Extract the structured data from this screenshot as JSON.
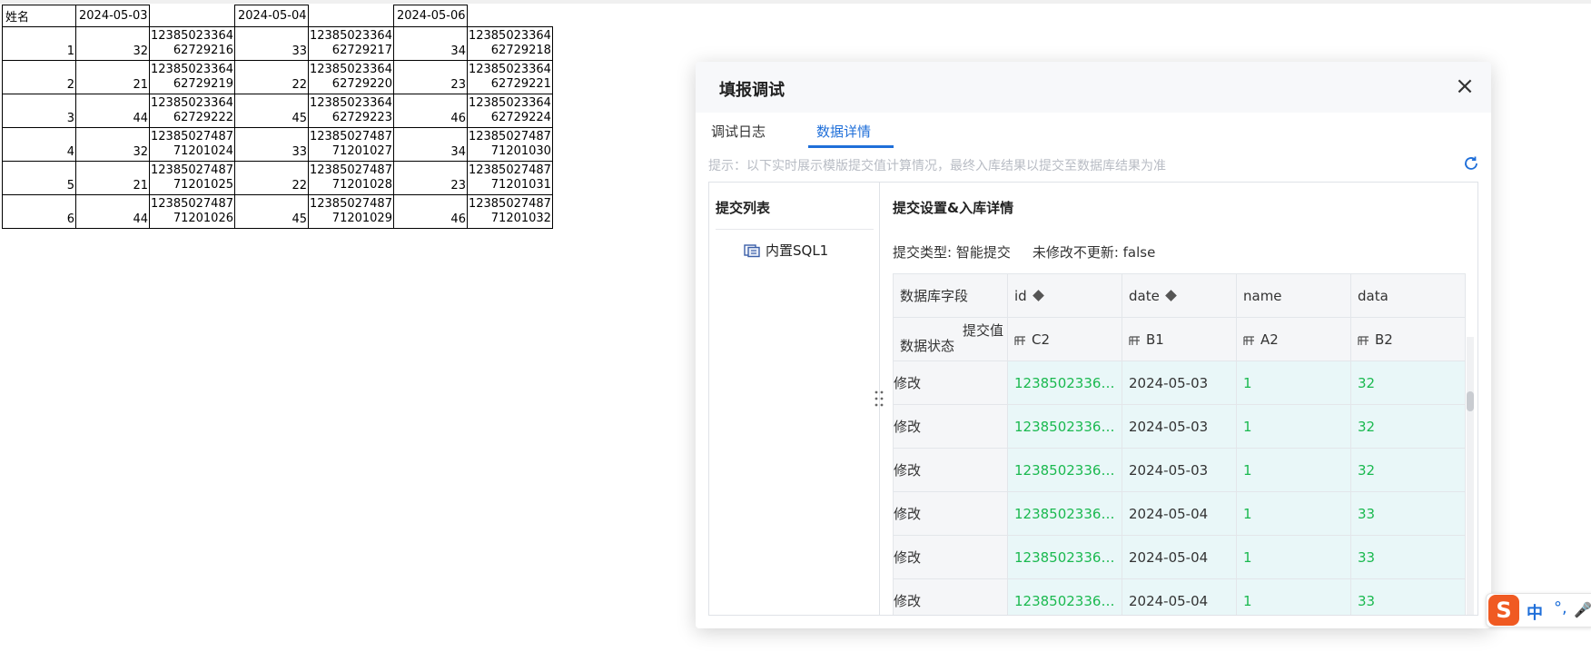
{
  "sheet": {
    "header": [
      "姓名",
      "2024-05-03",
      "",
      "2024-05-04",
      "",
      "2024-05-06",
      ""
    ],
    "rows": [
      [
        "1",
        "32",
        "12385023364\n62729216",
        "33",
        "12385023364\n62729217",
        "34",
        "12385023364\n62729218"
      ],
      [
        "2",
        "21",
        "12385023364\n62729219",
        "22",
        "12385023364\n62729220",
        "23",
        "12385023364\n62729221"
      ],
      [
        "3",
        "44",
        "12385023364\n62729222",
        "45",
        "12385023364\n62729223",
        "46",
        "12385023364\n62729224"
      ],
      [
        "4",
        "32",
        "12385027487\n71201024",
        "33",
        "12385027487\n71201027",
        "34",
        "12385027487\n71201030"
      ],
      [
        "5",
        "21",
        "12385027487\n71201025",
        "22",
        "12385027487\n71201028",
        "23",
        "12385027487\n71201031"
      ],
      [
        "6",
        "44",
        "12385027487\n71201026",
        "45",
        "12385027487\n71201029",
        "46",
        "12385027487\n71201032"
      ]
    ]
  },
  "dialog": {
    "title": "填报调试",
    "tabs": [
      "调试日志",
      "数据详情"
    ],
    "active_tab": "数据详情",
    "hint": "提示：以下实时展示模版提交值计算情况，最终入库结果以提交至数据库结果为准",
    "left_title": "提交列表",
    "sql_item": "内置SQL1",
    "right_title": "提交设置&入库详情",
    "submit_type_label": "提交类型: 智能提交",
    "no_update_label": "未修改不更新: false",
    "grid": {
      "corner_field": "数据库字段",
      "corner_value": "提交值",
      "corner_status": "数据状态",
      "fields": [
        "id",
        "date",
        "name",
        "data"
      ],
      "key_fields": [
        true,
        true,
        false,
        false
      ],
      "values": [
        "C2",
        "B1",
        "A2",
        "B2"
      ],
      "rows": [
        {
          "status": "修改",
          "cells": [
            "12385023364...",
            "2024-05-03",
            "1",
            "32"
          ]
        },
        {
          "status": "修改",
          "cells": [
            "12385023364...",
            "2024-05-03",
            "1",
            "32"
          ]
        },
        {
          "status": "修改",
          "cells": [
            "12385023364...",
            "2024-05-03",
            "1",
            "32"
          ]
        },
        {
          "status": "修改",
          "cells": [
            "12385023364...",
            "2024-05-04",
            "1",
            "33"
          ]
        },
        {
          "status": "修改",
          "cells": [
            "12385023364...",
            "2024-05-04",
            "1",
            "33"
          ]
        },
        {
          "status": "修改",
          "cells": [
            "12385023364...",
            "2024-05-04",
            "1",
            "33"
          ]
        }
      ]
    }
  },
  "ime": {
    "logo": "S",
    "mode": "中",
    "punct": "°,",
    "mic": "🎤"
  },
  "colors": {
    "accent": "#1f6fd9",
    "changed_value": "#1ab94f",
    "changed_bg": "#e9f7f8"
  }
}
